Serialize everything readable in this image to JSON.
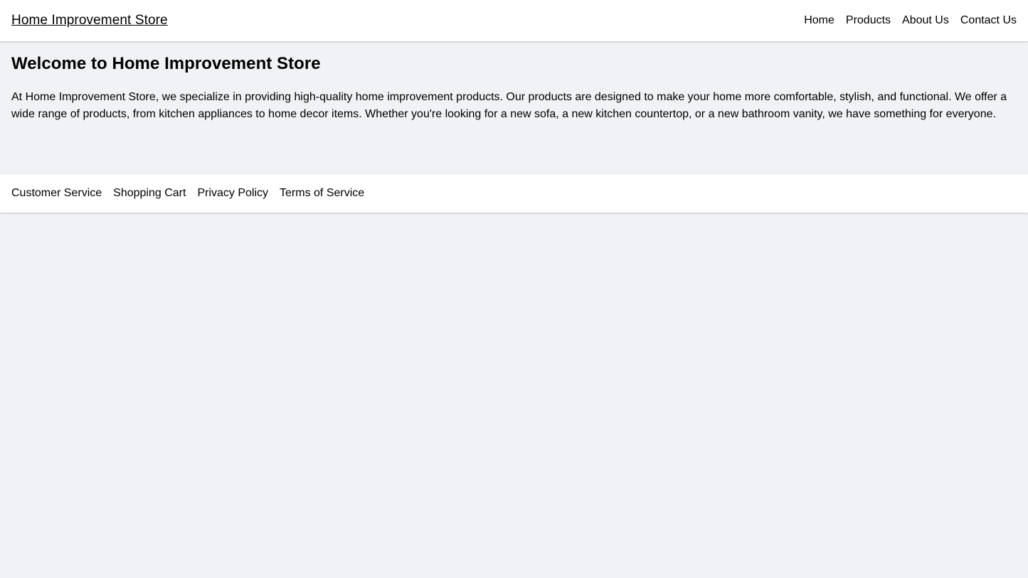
{
  "header": {
    "brand": "Home Improvement Store",
    "nav": [
      {
        "label": "Home"
      },
      {
        "label": "Products"
      },
      {
        "label": "About Us"
      },
      {
        "label": "Contact Us"
      }
    ]
  },
  "main": {
    "title": "Welcome to Home Improvement Store",
    "paragraph": "At Home Improvement Store, we specialize in providing high-quality home improvement products. Our products are designed to make your home more comfortable, stylish, and functional. We offer a wide range of products, from kitchen appliances to home decor items. Whether you're looking for a new sofa, a new kitchen countertop, or a new bathroom vanity, we have something for everyone."
  },
  "footer": {
    "links": [
      {
        "label": "Customer Service"
      },
      {
        "label": "Shopping Cart"
      },
      {
        "label": "Privacy Policy"
      },
      {
        "label": "Terms of Service"
      }
    ]
  },
  "theme": {
    "page_background": "#f1f2f6",
    "surface": "#ffffff",
    "text": "#000000"
  }
}
